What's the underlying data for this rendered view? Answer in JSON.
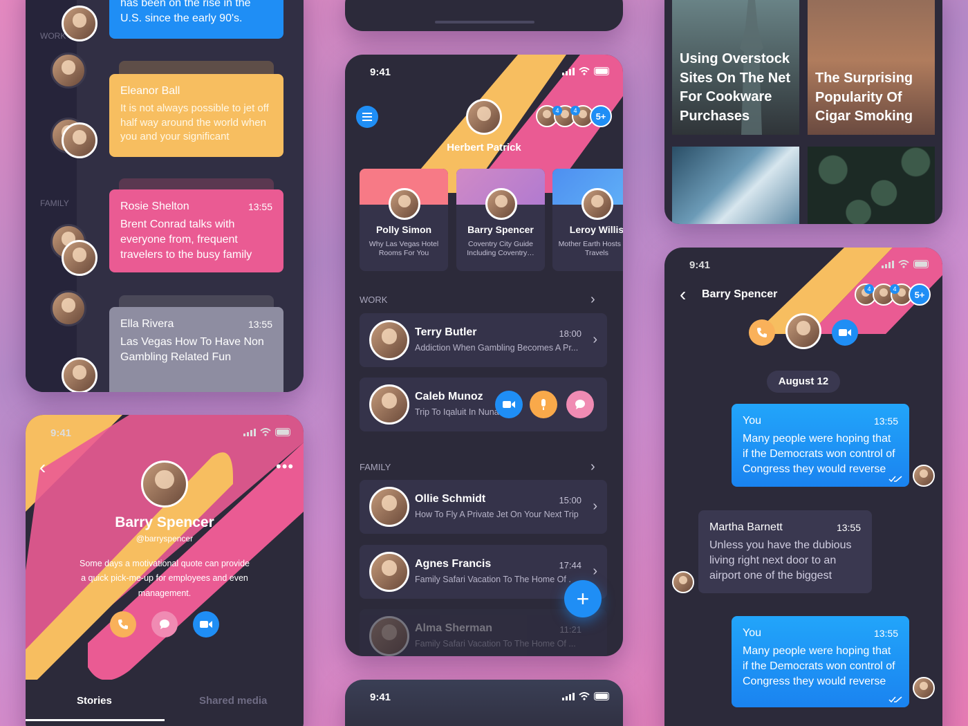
{
  "p1": {
    "section_work": "WORK",
    "section_family": "FAMILY",
    "top_text": "has been on the rise in the U.S. since the early 90's.",
    "messages": [
      {
        "name": "Eleanor Ball",
        "time": "",
        "text": "It is not always possible to jet off half way around the world when you and your significant",
        "color": "#f7be60"
      },
      {
        "name": "Rosie Shelton",
        "time": "13:55",
        "text": "Brent Conrad talks with everyone from, frequent travelers to the busy family",
        "color": "#ea5b93"
      },
      {
        "name": "Ella Rivera",
        "time": "13:55",
        "text": "Las Vegas How To Have Non Gambling Related Fun",
        "color": "#8e8da1"
      }
    ]
  },
  "p2": {
    "status_time": "9:41",
    "name": "Barry Spencer",
    "handle": "@barryspencer",
    "bio": "Some days a motivational quote can provide a quick pick-me-up for employees and even management.",
    "tabs": [
      "Stories",
      "Shared media"
    ]
  },
  "p3": {
    "status_time": "9:41",
    "user_name": "Herbert Patrick",
    "badge": "5+",
    "small_badge": "4",
    "cards": [
      {
        "name": "Polly Simon",
        "sub": "Why Las Vegas Hotel Rooms For You",
        "color": "#f77a86"
      },
      {
        "name": "Barry Spencer",
        "sub": "Coventry City Guide Including Coventry…",
        "color": "#c77db6"
      },
      {
        "name": "Leroy Willis",
        "sub": "Mother Earth Hosts Our Travels",
        "color": "#4e8ff0"
      }
    ],
    "section_work": "WORK",
    "section_family": "FAMILY",
    "rows": [
      {
        "name": "Terry Butler",
        "time": "18:00",
        "sub": "Addiction When Gambling Becomes A Pr..."
      },
      {
        "name": "Caleb Munoz",
        "time": "",
        "sub": "Trip To Iqaluit In Nunavut A C..."
      },
      {
        "name": "Ollie Schmidt",
        "time": "15:00",
        "sub": "How To Fly A Private Jet On Your Next Trip"
      },
      {
        "name": "Agnes Francis",
        "time": "17:44",
        "sub": "Family Safari Vacation To The Home Of ..."
      },
      {
        "name": "Alma Sherman",
        "time": "11:21",
        "sub": "Family Safari Vacation To The Home Of ..."
      }
    ],
    "fab": "+",
    "bottom_time": "9:41"
  },
  "p4": {
    "articles": [
      "Using Overstock Sites On The Net For Cookware Purchases",
      "The Surprising Popularity Of Cigar Smoking"
    ]
  },
  "p5": {
    "status_time": "9:41",
    "name": "Barry Spencer",
    "badge": "5+",
    "small_badge": "4",
    "date": "August 12",
    "messages": [
      {
        "name": "You",
        "time": "13:55",
        "text": "Many people were hoping that if the Democrats won control of Congress they would reverse"
      },
      {
        "name": "Martha Barnett",
        "time": "13:55",
        "text": "Unless you have the dubious living right next door to an airport one of the biggest"
      },
      {
        "name": "You",
        "time": "13:55",
        "text": "Many people were hoping that if the Democrats won control of Congress they would reverse"
      }
    ]
  },
  "colors": {
    "yellow": "#f7be60",
    "pink": "#ea5b93",
    "blue": "#1f8ef5",
    "panel": "#2c2a3a"
  }
}
